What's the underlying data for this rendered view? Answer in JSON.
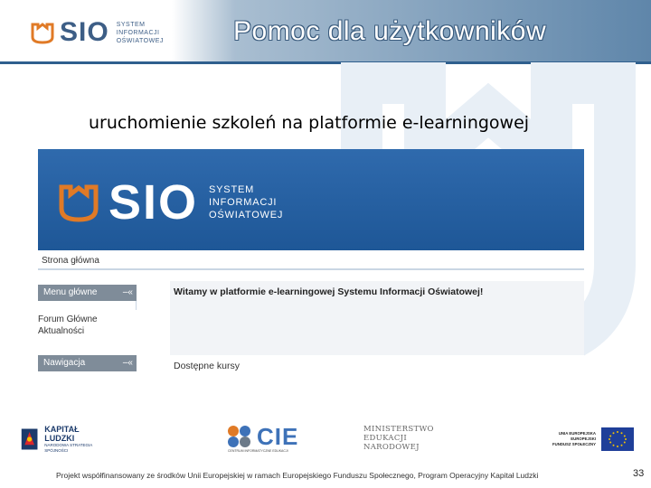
{
  "header": {
    "logo_text": "SIO",
    "logo_sub": [
      "SYSTEM",
      "INFORMACJI",
      "OŚWIATOWEJ"
    ],
    "title": "Pomoc dla użytkowników"
  },
  "subtitle": "uruchomienie szkoleń na platformie e-learningowej",
  "site": {
    "logo_text": "SIO",
    "logo_sub": [
      "SYSTEM",
      "INFORMACJI",
      "OŚWIATOWEJ"
    ],
    "breadcrumb": "Strona główna",
    "menu_block": {
      "label": "Menu główne",
      "control": "–«"
    },
    "menu_links": [
      "Forum Główne",
      "Aktualności"
    ],
    "nav_block": {
      "label": "Nawigacja",
      "control": "–«"
    },
    "welcome": "Witamy w platformie e-learningowej Systemu Informacji Oświatowej!",
    "courses_heading": "Dostępne kursy"
  },
  "footer": {
    "kapital_title": "KAPITAŁ LUDZKI",
    "kapital_sub": "NARODOWA STRATEGIA SPÓJNOŚCI",
    "cie": "CIE",
    "cie_sub": "CENTRUM INFORMATYCZNE EDUKACJI",
    "ministry": [
      "MINISTERSTWO",
      "EDUKACJI",
      "NARODOWEJ"
    ],
    "eu_text": [
      "UNIA EUROPEJSKA",
      "EUROPEJSKI",
      "FUNDUSZ SPOŁECZNY"
    ],
    "note": "Projekt współfinansowany ze środków Unii Europejskiej w ramach Europejskiego Funduszu Społecznego, Program Operacyjny Kapitał Ludzki",
    "page_number": "33"
  },
  "colors": {
    "brand_blue": "#3d5e86",
    "brand_orange": "#e07a26",
    "site_banner": "#2f6aad",
    "side_block": "#7f8c99"
  }
}
